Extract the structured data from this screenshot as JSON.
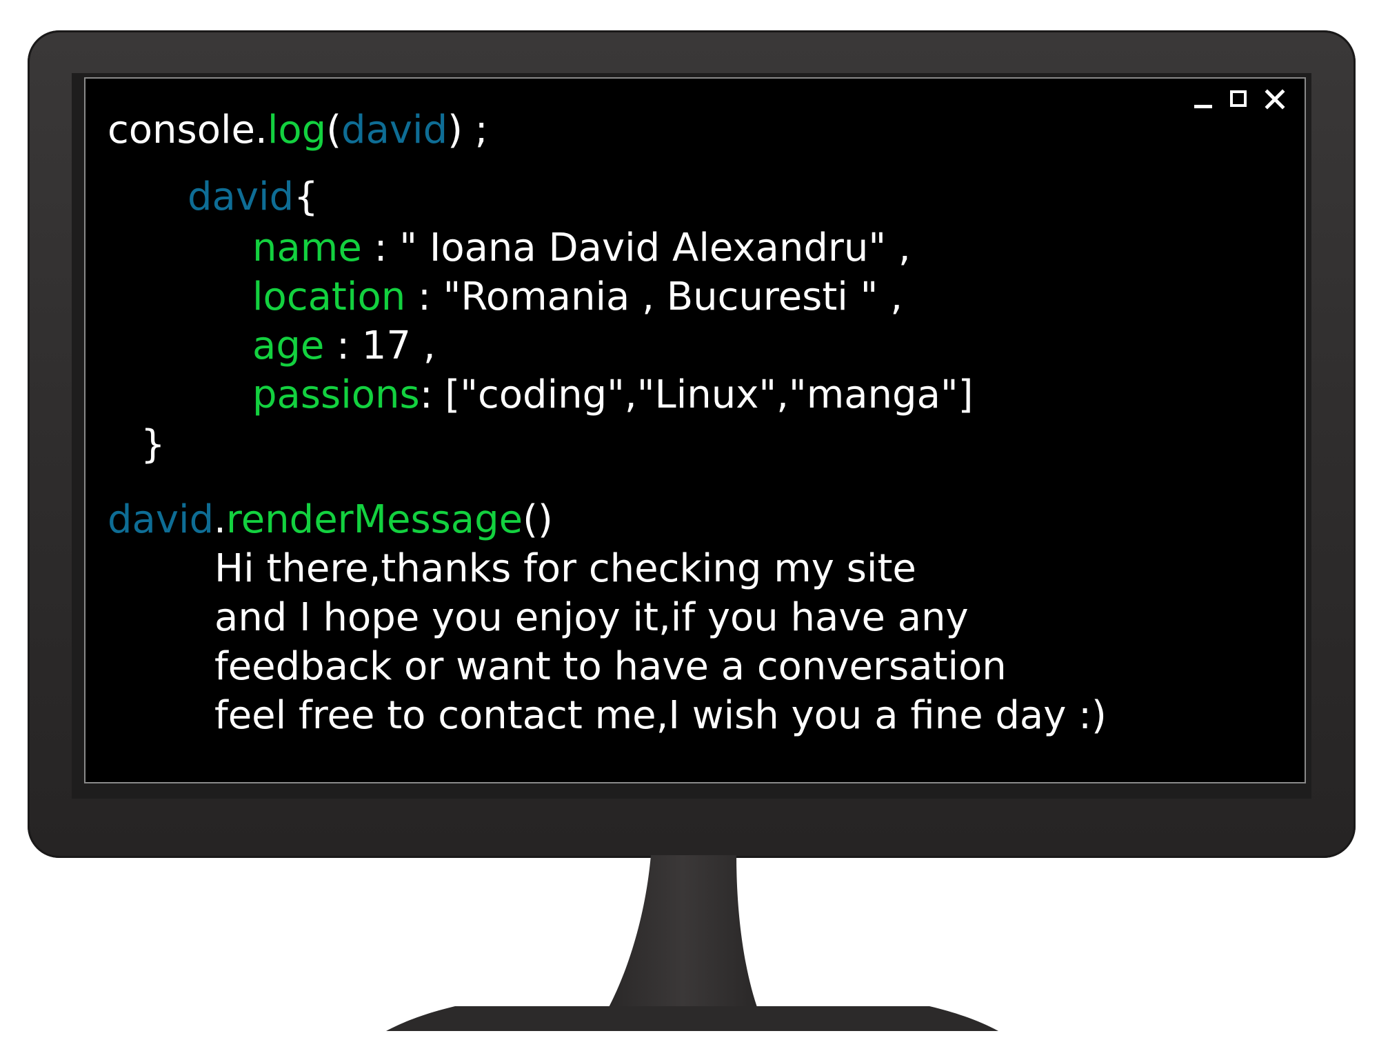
{
  "window": {
    "controls": [
      "minimize",
      "maximize",
      "close"
    ]
  },
  "colors": {
    "identifier_blue": "#0e6d95",
    "keyword_green": "#13d13f",
    "text_white": "#ffffff",
    "screen_bg": "#000000",
    "monitor_frame": "#2e2c2c"
  },
  "code": {
    "line1": {
      "obj": "console",
      "dot": ".",
      "method": "log",
      "open": "(",
      "arg": "david",
      "close": ") ;"
    },
    "line2": {
      "obj": "david",
      "brace": "{"
    },
    "props": [
      {
        "key": "name",
        "sep": " : ",
        "value": "\" Ioana David Alexandru\" ,"
      },
      {
        "key": "location",
        "sep": " : ",
        "value": "\"Romania , Bucuresti \" ,"
      },
      {
        "key": "age",
        "sep": " : ",
        "value": "17 ,"
      },
      {
        "key": "passions",
        "sep": ": ",
        "value": "[\"coding\",\"Linux\",\"manga\"]"
      }
    ],
    "close_brace": "}",
    "render": {
      "obj": "david",
      "dot": ".",
      "method": "renderMessage",
      "parens": "()"
    },
    "message": [
      "Hi there,thanks for checking my site",
      "and I hope you enjoy it,if you have any",
      "feedback or want to have a conversation",
      "feel free to contact me,I wish you a fine day :)"
    ]
  }
}
